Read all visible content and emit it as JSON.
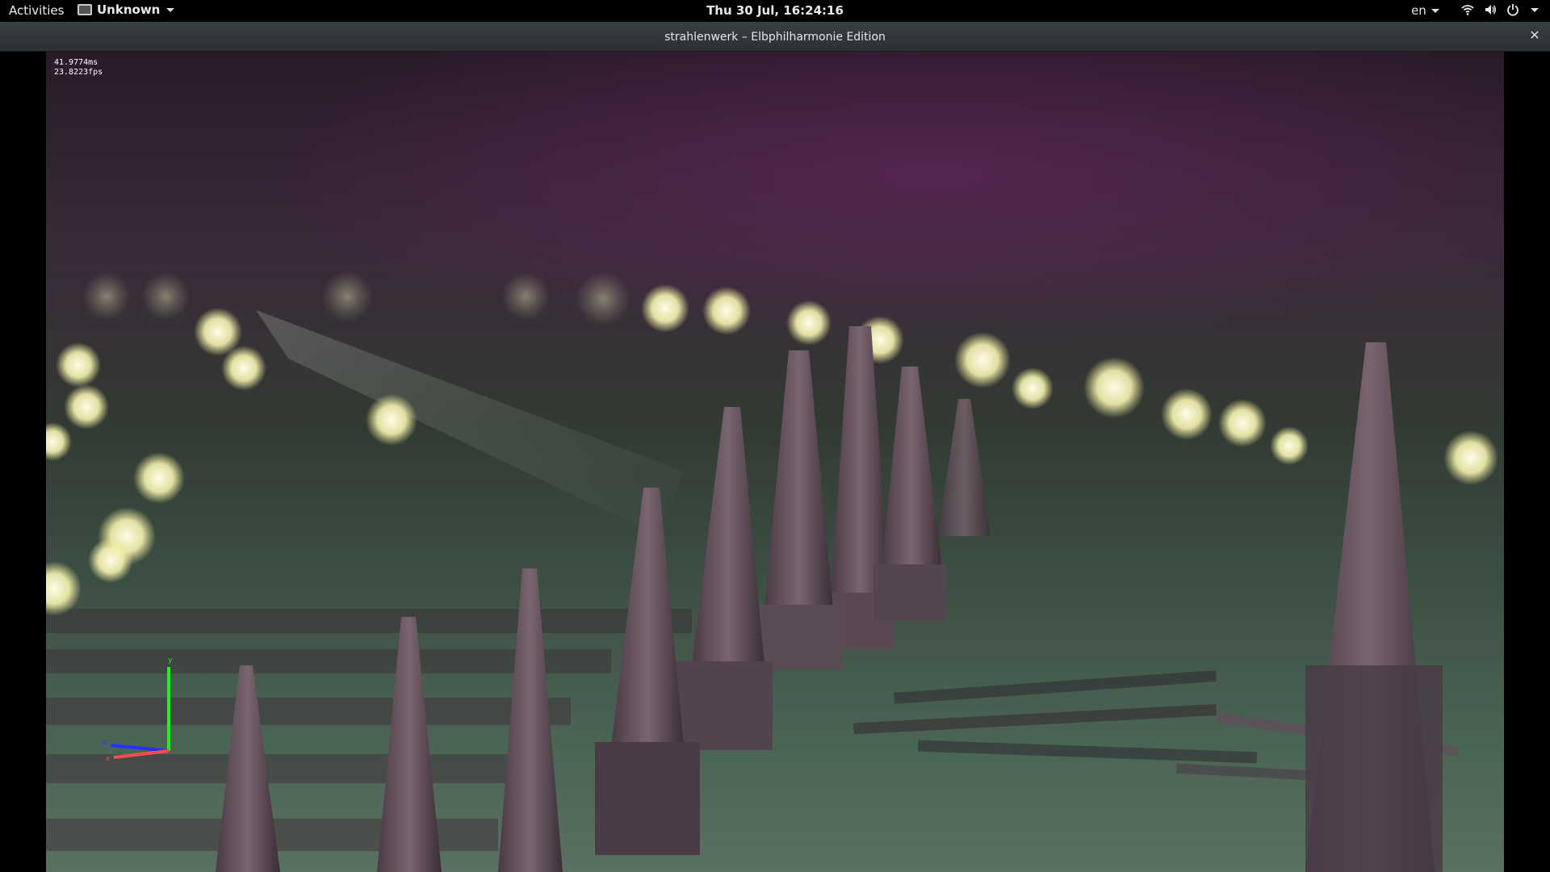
{
  "topbar": {
    "activities": "Activities",
    "app_menu": "Unknown",
    "clock": "Thu 30 Jul, 16:24:16",
    "language": "en"
  },
  "window": {
    "title": "strahlenwerk – Elbphilharmonie Edition",
    "close_glyph": "✕"
  },
  "viewport": {
    "frame_time": "41.9774ms",
    "fps": "23.8223fps",
    "axis_labels": {
      "y": "y",
      "z": "z",
      "x": "x"
    }
  },
  "icons": {
    "wifi": "wifi-icon",
    "volume": "volume-icon",
    "power": "power-icon",
    "app": "window-icon",
    "close": "close-icon"
  },
  "colors": {
    "axis_x": "#ff4d4d",
    "axis_y": "#22ee22",
    "axis_z": "#2233ff",
    "light_glow": "#fffbd0"
  }
}
